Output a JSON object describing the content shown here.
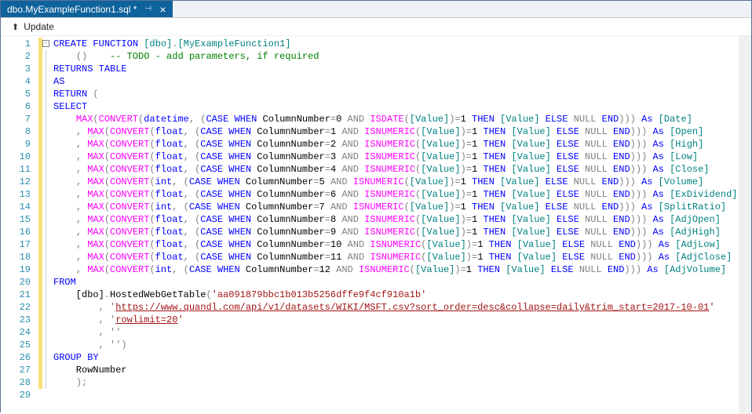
{
  "tab": {
    "title": "dbo.MyExampleFunction1.sql *",
    "close": "×"
  },
  "breadcrumb": {
    "label": "Update"
  },
  "gutter": [
    "1",
    "2",
    "3",
    "4",
    "5",
    "6",
    "7",
    "8",
    "9",
    "10",
    "11",
    "12",
    "13",
    "14",
    "15",
    "16",
    "17",
    "18",
    "19",
    "20",
    "21",
    "22",
    "23",
    "24",
    "25",
    "26",
    "27",
    "28",
    "29"
  ],
  "code": {
    "l1": {
      "a": "CREATE",
      "b": " FUNCTION",
      "c": " [dbo]",
      "d": ".",
      "e": "[MyExampleFunction1]"
    },
    "l2": {
      "a": "    ",
      "b": "()",
      "c": "    -- TODO - add parameters, if required"
    },
    "l3": {
      "a": "RETURNS",
      "b": " TABLE"
    },
    "l4": {
      "a": "AS"
    },
    "l5": {
      "a": "RETURN",
      "b": " ("
    },
    "l6": {
      "a": "SELECT"
    },
    "l7": {
      "pre": "    ",
      "a": "MAX",
      "b": "(",
      "c": "CONVERT",
      "d": "(",
      "e": "datetime",
      "f": ", (",
      "g": "CASE",
      "h": " WHEN",
      "i": " ColumnNumber",
      "j": "=",
      "k": "0 ",
      "l": "AND",
      "m": " ISDATE",
      "n": "(",
      "o": "[Value]",
      "p": ")=",
      "q": "1 ",
      "r": "THEN",
      "s": " [Value] ",
      "t": "ELSE",
      "u": " NULL",
      "v": " END",
      "w": "))) ",
      "x": "As",
      "y": " [Date]"
    },
    "rows": [
      {
        "col": "1",
        "fn": "ISNUMERIC",
        "alias": "[Open]",
        "type": "float"
      },
      {
        "col": "2",
        "fn": "ISNUMERIC",
        "alias": "[High]",
        "type": "float"
      },
      {
        "col": "3",
        "fn": "ISNUMERIC",
        "alias": "[Low]",
        "type": "float"
      },
      {
        "col": "4",
        "fn": "ISNUMERIC",
        "alias": "[Close]",
        "type": "float"
      },
      {
        "col": "5",
        "fn": "ISNUMERIC",
        "alias": "[Volume]",
        "type": "int"
      },
      {
        "col": "6",
        "fn": "ISNUMERIC",
        "alias": "[ExDividend]",
        "type": "float"
      },
      {
        "col": "7",
        "fn": "ISNUMERIC",
        "alias": "[SplitRatio]",
        "type": "int"
      },
      {
        "col": "8",
        "fn": "ISNUMERIC",
        "alias": "[AdjOpen]",
        "type": "float"
      },
      {
        "col": "9",
        "fn": "ISNUMERIC",
        "alias": "[AdjHigh]",
        "type": "float"
      },
      {
        "col": "10",
        "fn": "ISNUMERIC",
        "alias": "[AdjLow]",
        "type": "float"
      },
      {
        "col": "11",
        "fn": "ISNUMERIC",
        "alias": "[AdjClose]",
        "type": "float"
      },
      {
        "col": "12",
        "fn": "ISNUMERIC",
        "alias": "[AdjVolume]",
        "type": "int"
      }
    ],
    "l20": {
      "a": "FROM"
    },
    "l21": {
      "a": "    [dbo]",
      "b": ".",
      "c": "HostedWebGetTable",
      "d": "(",
      "e": "'aa091879bbc1b013b5256dffe9f4cf910a1b'"
    },
    "l22": {
      "a": "        , '",
      "b": "https://www.quandl.com/api/v1/datasets/WIKI/MSFT.csv?sort_order=desc&collapse=daily&trim_start=2017-10-01",
      "c": "'"
    },
    "l23": {
      "a": "        ",
      "b": ", '",
      "c": "rowlimit=20",
      "d": "'"
    },
    "l24": {
      "a": "        ",
      "b": ", ''"
    },
    "l25": {
      "a": "        ",
      "b": ", ''",
      "c": ")"
    },
    "l26": {
      "a": "GROUP",
      "b": " BY"
    },
    "l27": {
      "a": "    RowNumber"
    },
    "l28": {
      "a": "    );"
    }
  }
}
